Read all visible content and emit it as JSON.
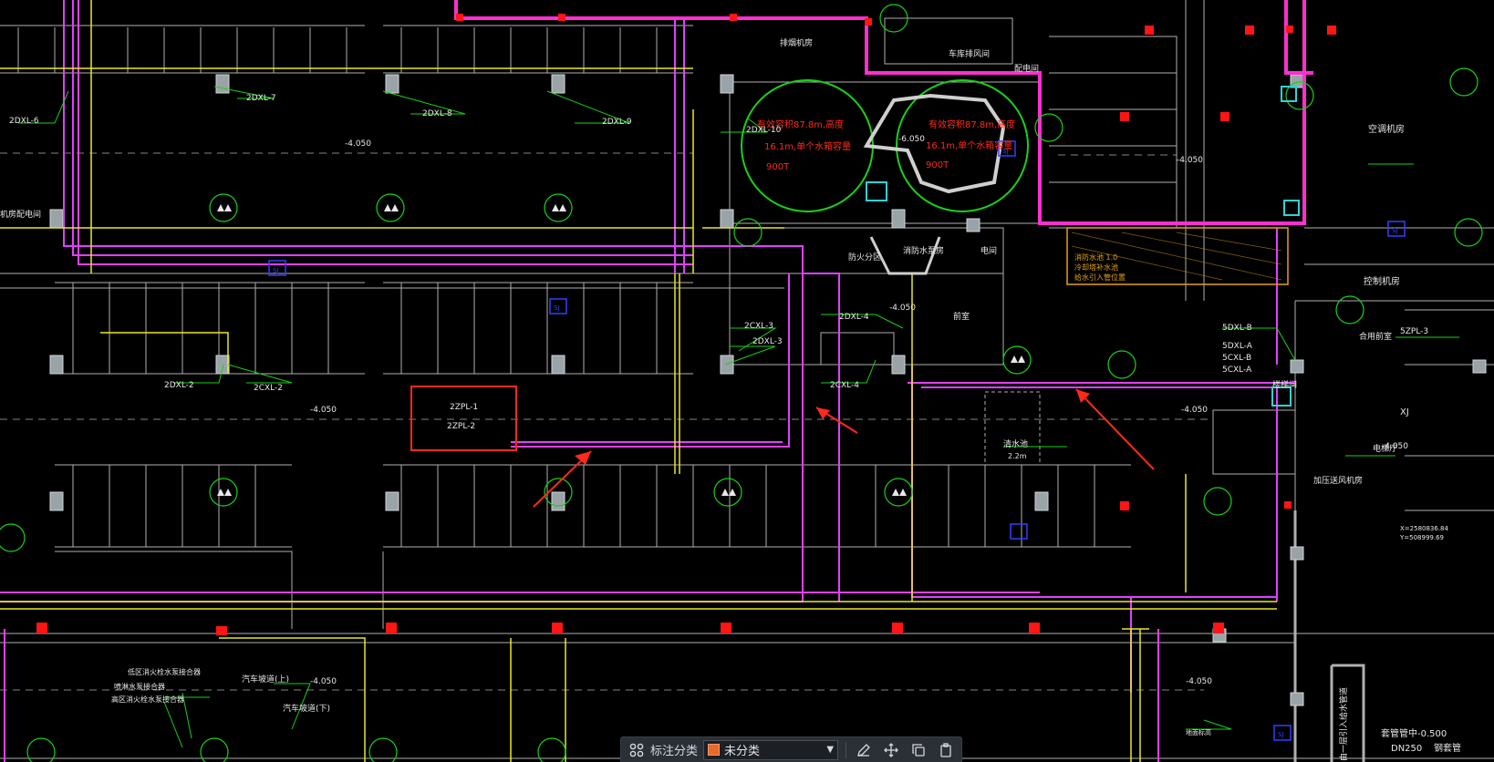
{
  "toolbar": {
    "label": "标注分类",
    "selected_value": "未分类",
    "swatch_color": "#e8692c",
    "icons": [
      "grid-icon",
      "edit-icon",
      "move-icon",
      "copy-icon",
      "paste-icon"
    ]
  },
  "drawing": {
    "background": "#000000",
    "colors": {
      "pink": "#ff2fd0",
      "magenta": "#e040ff",
      "yellow": "#e7e729",
      "green": "#19d119",
      "white": "#d8d8d8",
      "red": "#ff1515",
      "cyan": "#2ed3d3",
      "blue": "#3040ff",
      "orange": "#e6a015"
    },
    "labels": {
      "room_a": "排烟机房",
      "room_b": "车库排风间",
      "room_c": "配电间",
      "room_d": "空调机房",
      "room_e": "控制机房",
      "room_f": "消防水泵房",
      "room_g": "电间",
      "room_h": "防火分区",
      "room_i": "楼梯间",
      "room_j": "加压送风机房",
      "room_k": "电梯厅",
      "room_l": "合用前室",
      "room_m": "前室",
      "room_n": "机房配电间",
      "tank_1_line1": "有效容积87.8m,高度",
      "tank_1_line2": "16.1m,单个水箱容量",
      "tank_1_line3": "900T",
      "tank_2_line1": "有效容积87.8m,高度",
      "tank_2_line2": "16.1m,单个水箱容量",
      "tank_2_line3": "900T",
      "elev_1": "-4.050",
      "elev_2": "-4.050",
      "elev_3": "-4.050",
      "elev_4": "-4.050",
      "elev_5": "-6.050",
      "elev_6": "-4.050",
      "elev_7": "-4.050",
      "elev_8": "-4.050",
      "elev_9": "-4.050",
      "pipe_1": "2DXL-6",
      "pipe_2": "2DXL-7",
      "pipe_3": "2DXL-8",
      "pipe_4": "2DXL-9",
      "pipe_5": "2DXL-10",
      "pipe_6": "2DXL-2",
      "pipe_7": "2CXL-2",
      "pipe_8": "2CXL-3",
      "pipe_9": "2DXL-3",
      "pipe_10": "2DXL-4",
      "pipe_11": "2CXL-4",
      "pipe_12": "2ZPL-1",
      "pipe_13": "2ZPL-2",
      "pipe_14": "5DXL-B",
      "pipe_15": "5DXL-A",
      "pipe_16": "5CXL-B",
      "pipe_17": "5CXL-A",
      "pipe_18": "5ZPL-3",
      "sj": "SJ",
      "xj": "XJ",
      "clear_height": "清水池",
      "clear_height_val": "2.2m",
      "note_1": "低区消火栓水泵接合器",
      "note_2": "喷淋水泵接合器",
      "note_3": "高区消火栓水泵接合器",
      "note_4": "汽车坡道(上)",
      "note_5": "汽车坡道(下)",
      "note_6": "地面标高",
      "dn_label": "DN250",
      "dn_label2": "钢套管",
      "pipe_depth": "套管管中-0.500",
      "coord_x": "X=2580836.84",
      "coord_y": "Y=508999.69",
      "vertical_note": "由一层引入给水管道",
      "hatch_note_1": "消防水池 1.0",
      "hatch_note_2": "冷却塔补水池",
      "hatch_note_3": "给水引入管位置"
    }
  }
}
